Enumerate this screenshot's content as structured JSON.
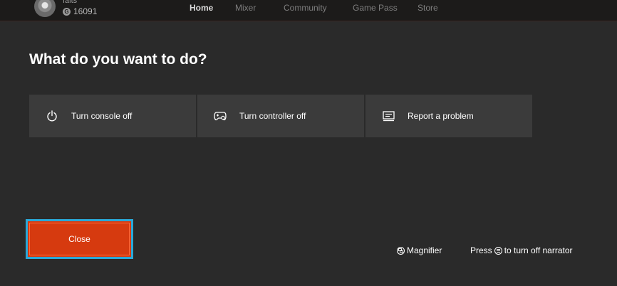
{
  "header": {
    "gamertag": "faits",
    "gamerscore": "16091",
    "gamerscore_icon": "G",
    "tabs": [
      {
        "label": "Home",
        "active": true
      },
      {
        "label": "Mixer",
        "active": false
      },
      {
        "label": "Community",
        "active": false
      },
      {
        "label": "Game Pass",
        "active": false
      },
      {
        "label": "Store",
        "active": false
      }
    ]
  },
  "dialog": {
    "title": "What do you want to do?",
    "options": [
      {
        "label": "Turn console off",
        "icon": "power-icon"
      },
      {
        "label": "Turn controller off",
        "icon": "controller-icon"
      },
      {
        "label": "Report a problem",
        "icon": "feedback-icon"
      }
    ],
    "close_label": "Close"
  },
  "footer": {
    "magnifier_label": "Magnifier",
    "narrator_prefix": "Press",
    "narrator_suffix": "to turn off narrator"
  },
  "colors": {
    "background": "#2a2a2a",
    "tile": "#3b3b3b",
    "close_button": "#d63a0f",
    "focus_ring": "#2aa8d8"
  }
}
